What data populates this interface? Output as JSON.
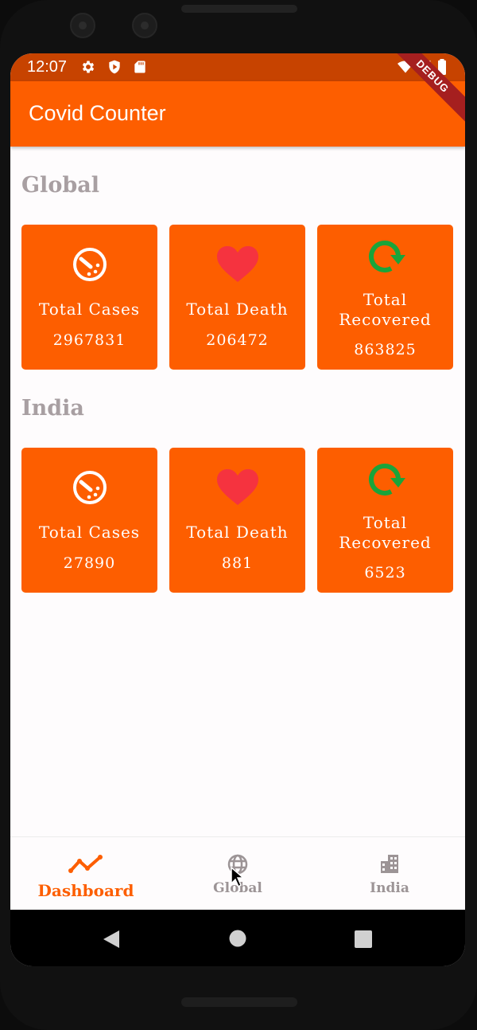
{
  "status_bar": {
    "time": "12:07"
  },
  "app_bar": {
    "title": "Covid Counter",
    "debug_banner": "DEBUG"
  },
  "sections": [
    {
      "title": "Global",
      "cards": [
        {
          "icon": "speedometer-icon",
          "label": "Total Cases",
          "value": "2967831"
        },
        {
          "icon": "heart-icon",
          "label": "Total Death",
          "value": "206472"
        },
        {
          "icon": "refresh-icon",
          "label_line1": "Total",
          "label_line2": "Recovered",
          "value": "863825"
        }
      ]
    },
    {
      "title": "India",
      "cards": [
        {
          "icon": "speedometer-icon",
          "label": "Total Cases",
          "value": "27890"
        },
        {
          "icon": "heart-icon",
          "label": "Total Death",
          "value": "881"
        },
        {
          "icon": "refresh-icon",
          "label_line1": "Total",
          "label_line2": "Recovered",
          "value": "6523"
        }
      ]
    }
  ],
  "bottom_nav": {
    "items": [
      {
        "label": "Dashboard",
        "icon": "trending-up-icon",
        "active": true
      },
      {
        "label": "Global",
        "icon": "globe-icon",
        "active": false
      },
      {
        "label": "India",
        "icon": "building-icon",
        "active": false
      }
    ]
  },
  "colors": {
    "primary": "#fd5e00",
    "status_bar": "#c74300",
    "heart": "#f5333f",
    "recovered": "#1aa43a",
    "section_title": "#a89fa2",
    "nav_inactive": "#9c9496"
  }
}
